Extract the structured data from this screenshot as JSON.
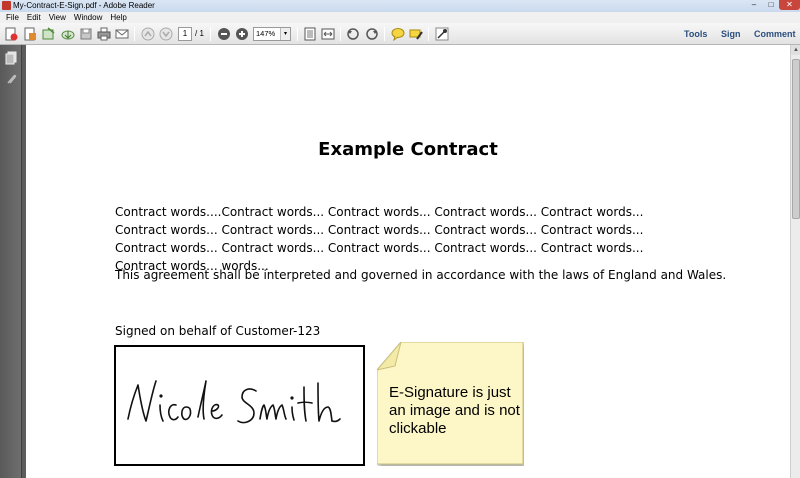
{
  "window": {
    "title": "My-Contract-E-Sign.pdf - Adobe Reader",
    "controls": {
      "minimize": "–",
      "maximize": "□",
      "close": "✕"
    }
  },
  "menu": [
    "File",
    "Edit",
    "View",
    "Window",
    "Help"
  ],
  "toolbar": {
    "current_page": "1",
    "page_total": "/ 1",
    "zoom": "147%",
    "zoom_arrow": "▾",
    "right_links": {
      "tools": "Tools",
      "sign": "Sign",
      "comment": "Comment"
    }
  },
  "icons": {
    "toolbar": [
      "create-pdf-icon",
      "open-icon",
      "share-icon",
      "cloud-icon",
      "save-icon",
      "print-icon",
      "email-icon",
      "previous-page-icon",
      "next-page-icon",
      "zoom-out-icon",
      "zoom-in-icon",
      "fit-page-icon",
      "fit-width-icon",
      "rotate-left-icon",
      "rotate-right-icon",
      "sticky-note-icon",
      "highlight-icon",
      "sign-tool-icon"
    ],
    "nav": [
      "page-thumbnails-icon",
      "attachments-icon"
    ]
  },
  "document": {
    "title": "Example Contract",
    "paragraph": "Contract words....Contract words... Contract words... Contract words... Contract words... Contract words... Contract words... Contract words... Contract words... Contract words... Contract words... Contract words... Contract words... Contract words... Contract words... Contract words... words...",
    "law": "This agreement shall be interpreted and governed in accordance with the laws of England and Wales.",
    "signed_on_behalf": "Signed on behalf of Customer-123",
    "signature_name": "Nicole Smith"
  },
  "note": {
    "text": "E-Signature is just an image and is not clickable",
    "color": "#fdf7c8"
  },
  "scrollbar": {
    "up_arrow": "▲"
  }
}
